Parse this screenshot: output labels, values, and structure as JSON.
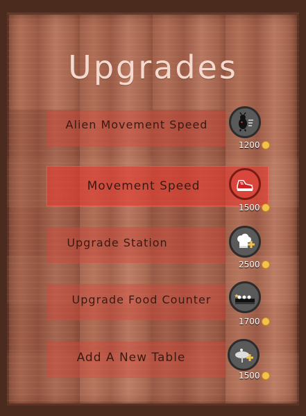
{
  "screen": {
    "title": "Upgrades"
  },
  "upgrades": [
    {
      "label": "Alien Movement Speed",
      "price": "1200",
      "icon": "alien-speed-icon",
      "highlighted": false
    },
    {
      "label": "Movement Speed",
      "price": "1500",
      "icon": "sneaker-icon",
      "highlighted": true
    },
    {
      "label": "Upgrade Station",
      "price": "2500",
      "icon": "chef-hat-plus-icon",
      "highlighted": false
    },
    {
      "label": "Upgrade Food Counter",
      "price": "1700",
      "icon": "food-counter-icon",
      "highlighted": false
    },
    {
      "label": "Add A New Table",
      "price": "1500",
      "icon": "table-plus-icon",
      "highlighted": false
    }
  ],
  "colors": {
    "bar": "#d6463c",
    "bar_highlight": "#e2382e",
    "title": "#f4d9cf",
    "coin": "#f2c24f"
  }
}
